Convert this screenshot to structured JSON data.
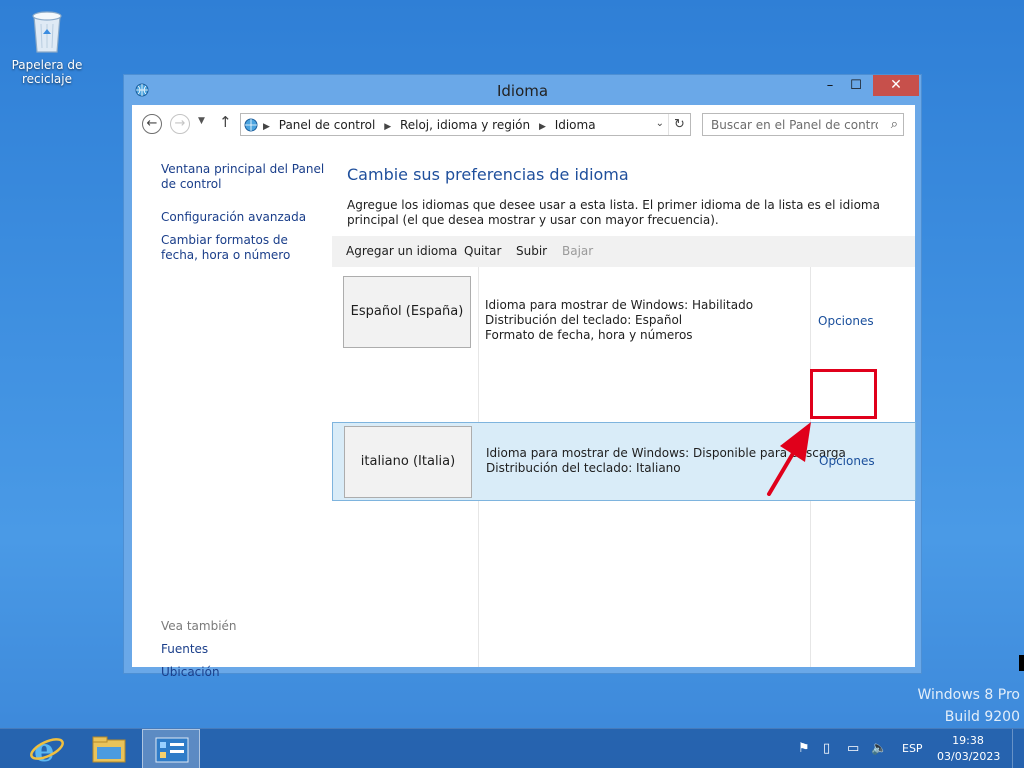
{
  "desktop": {
    "recycle_bin_label": "Papelera de reciclaje",
    "watermark_line1": "Windows 8 Pro",
    "watermark_line2": "Build 9200"
  },
  "window": {
    "title": "Idioma",
    "controls": {
      "minimize": "–",
      "maximize": "☐",
      "close": "✕"
    }
  },
  "address_bar": {
    "back_icon": "back-arrow-icon",
    "forward_icon": "forward-arrow-icon",
    "breadcrumbs": [
      "Panel de control",
      "Reloj, idioma y región",
      "Idioma"
    ],
    "search_placeholder": "Buscar en el Panel de control"
  },
  "left_pane": {
    "links": [
      "Ventana principal del Panel de control",
      "Configuración avanzada",
      "Cambiar formatos de fecha, hora o número"
    ],
    "see_also_label": "Vea también",
    "see_also_links": [
      "Fuentes",
      "Ubicación"
    ]
  },
  "main": {
    "heading": "Cambie sus preferencias de idioma",
    "intro": "Agregue los idiomas que desee usar a esta lista. El primer idioma de la lista es el idioma principal (el que desea mostrar y usar con mayor frecuencia).",
    "toolbar": {
      "add": "Agregar un idioma",
      "remove": "Quitar",
      "up": "Subir",
      "down": "Bajar"
    },
    "languages": [
      {
        "name": "Español (España)",
        "lines": [
          "Idioma para mostrar de Windows: Habilitado",
          "Distribución del teclado: Español",
          "Formato de fecha, hora y números"
        ],
        "options": "Opciones",
        "selected": false
      },
      {
        "name": "italiano (Italia)",
        "lines": [
          "Idioma para mostrar de Windows: Disponible para descarga",
          "Distribución del teclado: Italiano"
        ],
        "options": "Opciones",
        "selected": true
      }
    ]
  },
  "annotation": {
    "color": "#e0001b"
  },
  "taskbar": {
    "apps": [
      "internet-explorer-icon",
      "file-explorer-icon",
      "control-panel-icon"
    ],
    "tray_language": "ESP",
    "time": "19:38",
    "date": "03/03/2023"
  }
}
